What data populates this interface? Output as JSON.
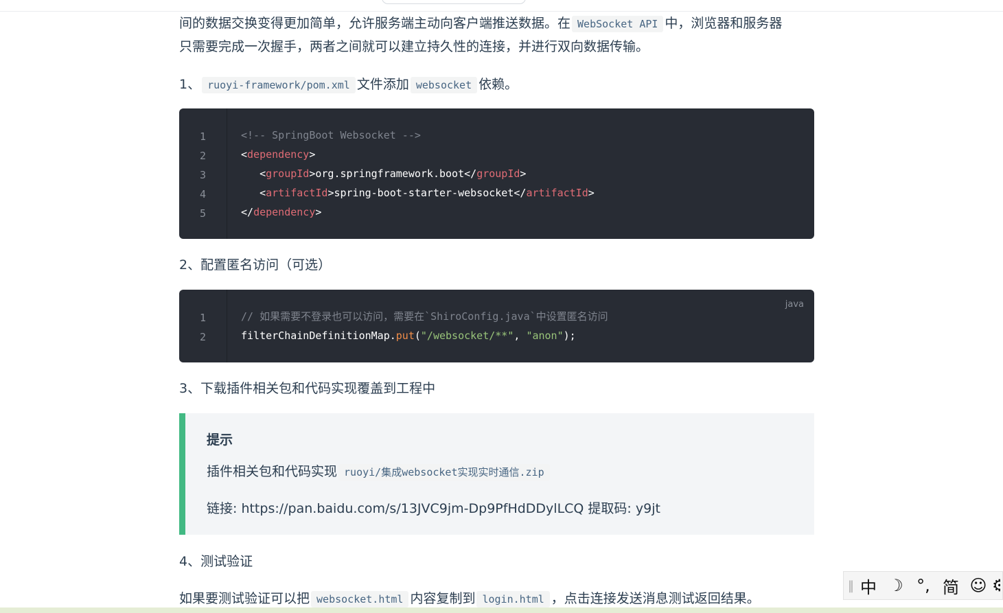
{
  "intro": {
    "line1_a": "间的数据交换变得更加简单，允许服务端主动向客户端推送数据。在",
    "line1_code": "WebSocket API",
    "line1_b": "中，浏览器和服务器",
    "line2": "只需要完成一次握手，两者之间就可以建立持久性的连接，并进行双向数据传输。"
  },
  "step1": {
    "prefix": "1、",
    "code1": "ruoyi-framework/pom.xml",
    "middle": "文件添加",
    "code2": "websocket",
    "suffix": "依赖。"
  },
  "codeblock1": {
    "line_numbers": [
      "1",
      "2",
      "3",
      "4",
      "5"
    ],
    "comment": "<!-- SpringBoot Websocket -->",
    "lt": "<",
    "gt": ">",
    "lt_slash": "</",
    "dependency": "dependency",
    "groupId": "groupId",
    "groupId_value": "org.springframework.boot",
    "artifactId": "artifactId",
    "artifactId_value": "spring-boot-starter-websocket"
  },
  "step2": {
    "text": "2、配置匿名访问（可选）"
  },
  "codeblock2": {
    "lang": "java",
    "line_numbers": [
      "1",
      "2"
    ],
    "comment": "// 如果需要不登录也可以访问，需要在`ShiroConfig.java`中设置匿名访问",
    "obj": "filterChainDefinitionMap",
    "dot": ".",
    "method": "put",
    "open": "(",
    "arg1": "\"/websocket/**\"",
    "comma": ", ",
    "arg2": "\"anon\"",
    "close": ");"
  },
  "step3": {
    "text": "3、下载插件相关包和代码实现覆盖到工程中"
  },
  "tip": {
    "title": "提示",
    "line1_text": "插件相关包和代码实现",
    "line1_code": "ruoyi/集成websocket实现实时通信.zip",
    "line2": "链接: https://pan.baidu.com/s/13JVC9jm-Dp9PfHdDDylLCQ 提取码: y9jt"
  },
  "step4": {
    "text": "4、测试验证"
  },
  "final": {
    "prefix": "如果要测试验证可以把",
    "code1": "websocket.html",
    "middle": "内容复制到",
    "code2": "login.html",
    "suffix": "，点击连接发送消息测试返回结果。"
  },
  "ime": {
    "grip": "‖",
    "mode": "中",
    "moon": "☽",
    "punct": "°,",
    "simplified": "简",
    "emoji": "☺",
    "settings": "⚙"
  }
}
